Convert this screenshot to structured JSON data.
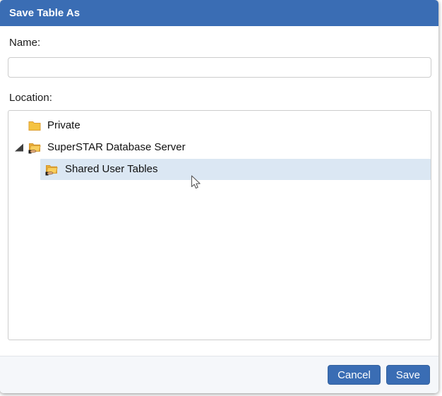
{
  "dialog": {
    "title": "Save Table As",
    "name_field": {
      "label": "Name:",
      "value": "",
      "placeholder": ""
    },
    "location": {
      "label": "Location:",
      "tree": {
        "items": [
          {
            "label": "Private",
            "level": 1,
            "icon": "folder",
            "expanded": false,
            "selected": false
          },
          {
            "label": "SuperSTAR Database Server",
            "level": 1,
            "icon": "shared-folder",
            "expanded": true,
            "selected": false
          },
          {
            "label": "Shared User Tables",
            "level": 2,
            "icon": "shared-folder",
            "expanded": false,
            "selected": true
          }
        ]
      }
    },
    "footer": {
      "cancel_label": "Cancel",
      "save_label": "Save"
    },
    "colors": {
      "accent": "#3a6db4",
      "selection_background": "#dbe7f3",
      "footer_background": "#f5f7fa"
    }
  }
}
